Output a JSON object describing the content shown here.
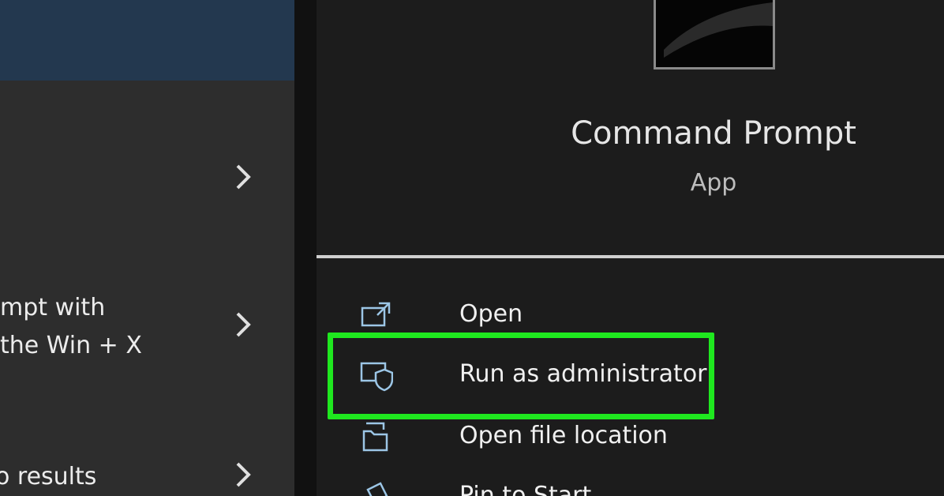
{
  "window": {
    "app_name": "Command Prompt",
    "app_type": "App"
  },
  "left_panel": {
    "items": [
      {
        "text": "",
        "has_chevron": true
      },
      {
        "text_line1": "mpt with",
        "text_line2": "the Win + X",
        "has_chevron": true
      },
      {
        "text": "o results",
        "has_chevron": true
      }
    ]
  },
  "context_menu": {
    "items": [
      {
        "label": "Open",
        "icon": "open-external-icon"
      },
      {
        "label": "Run as administrator",
        "icon": "shield-admin-icon"
      },
      {
        "label": "Open file location",
        "icon": "folder-location-icon"
      },
      {
        "label": "Pin to Start",
        "icon": "pin-icon"
      }
    ]
  },
  "colors": {
    "highlight": "#1fe81f",
    "left_selected": "#23384f"
  }
}
